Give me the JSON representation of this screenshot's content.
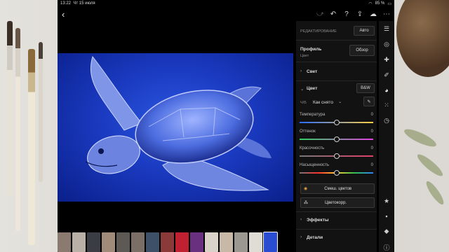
{
  "status": {
    "time": "13:22",
    "date": "Чт 15 июля",
    "battery": "85 %"
  },
  "toolbar": {
    "back": "‹",
    "icons": [
      "magic-icon",
      "undo-icon",
      "help-icon",
      "share-icon",
      "cloud-icon",
      "more-icon"
    ]
  },
  "panel": {
    "edit_label": "РЕДАКТИРОВАНИЕ",
    "auto_button": "Авто",
    "profile_label": "Профиль",
    "profile_value": "Цвет",
    "browse_button": "Обзор",
    "light_label": "Свет",
    "color_label": "Цвет",
    "bw_button": "B&W",
    "wb_prefix": "Ч/Б",
    "wb_value": "Как снято",
    "sliders": [
      {
        "name": "Температура",
        "value": "0",
        "level": 0.5
      },
      {
        "name": "Оттенок",
        "value": "0",
        "level": 0.5
      },
      {
        "name": "Красочность",
        "value": "0",
        "level": 0.5
      },
      {
        "name": "Насыщенность",
        "value": "0",
        "level": 0.5
      }
    ],
    "mix_button": "Смеш. цветов",
    "grading_button": "Цветокорр.",
    "effects_label": "Эффекты",
    "detail_label": "Детали"
  },
  "colors": {
    "panel_bg": "#121212",
    "photo_blue": "#1a3ac0"
  }
}
